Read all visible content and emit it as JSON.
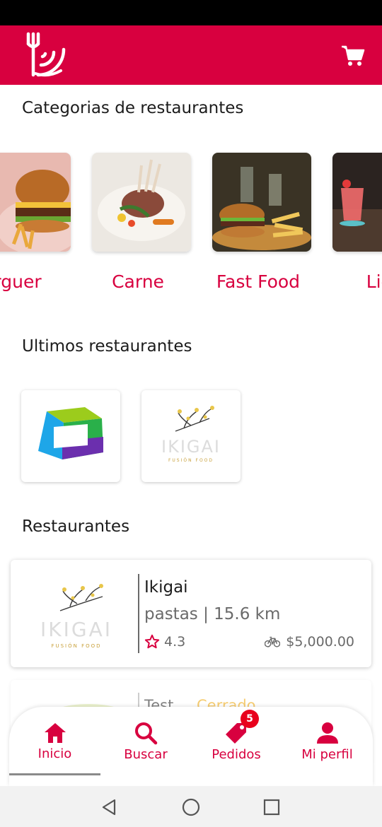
{
  "header": {
    "logo_icon": "restaurant-delivery-logo",
    "cart_icon": "cart-icon",
    "brand_color": "#d8003f"
  },
  "categories": {
    "title": "Categorias de restaurantes",
    "items": [
      {
        "label": "rguer",
        "icon": "burger-photo"
      },
      {
        "label": "Carne",
        "icon": "meat-photo"
      },
      {
        "label": "Fast Food",
        "icon": "fastfood-photo"
      },
      {
        "label": "Lic",
        "icon": "drinks-photo"
      }
    ]
  },
  "recent": {
    "title": "Ultimos restaurantes",
    "items": [
      {
        "name": "cube-logo"
      },
      {
        "name": "ikigai-logo",
        "text": "IKIGAI",
        "subtext": "FUSIÓN FOOD"
      }
    ]
  },
  "restaurants": {
    "title": "Restaurantes",
    "items": [
      {
        "name": "Ikigai",
        "meta": "pastas | 15.6 km",
        "rating": "4.3",
        "fee": "$5,000.00",
        "logo_text": "IKIGAI",
        "logo_subtext": "FUSIÓN FOOD"
      },
      {
        "name": "Test",
        "status": "Cerrado"
      }
    ]
  },
  "nav": {
    "items": [
      {
        "label": "Inicio",
        "icon": "home-icon",
        "active": true
      },
      {
        "label": "Buscar",
        "icon": "search-icon"
      },
      {
        "label": "Pedidos",
        "icon": "tag-icon",
        "badge": "5"
      },
      {
        "label": "Mi perfil",
        "icon": "user-icon"
      }
    ]
  },
  "system_nav": [
    "back-icon",
    "home-circle-icon",
    "recents-icon"
  ]
}
